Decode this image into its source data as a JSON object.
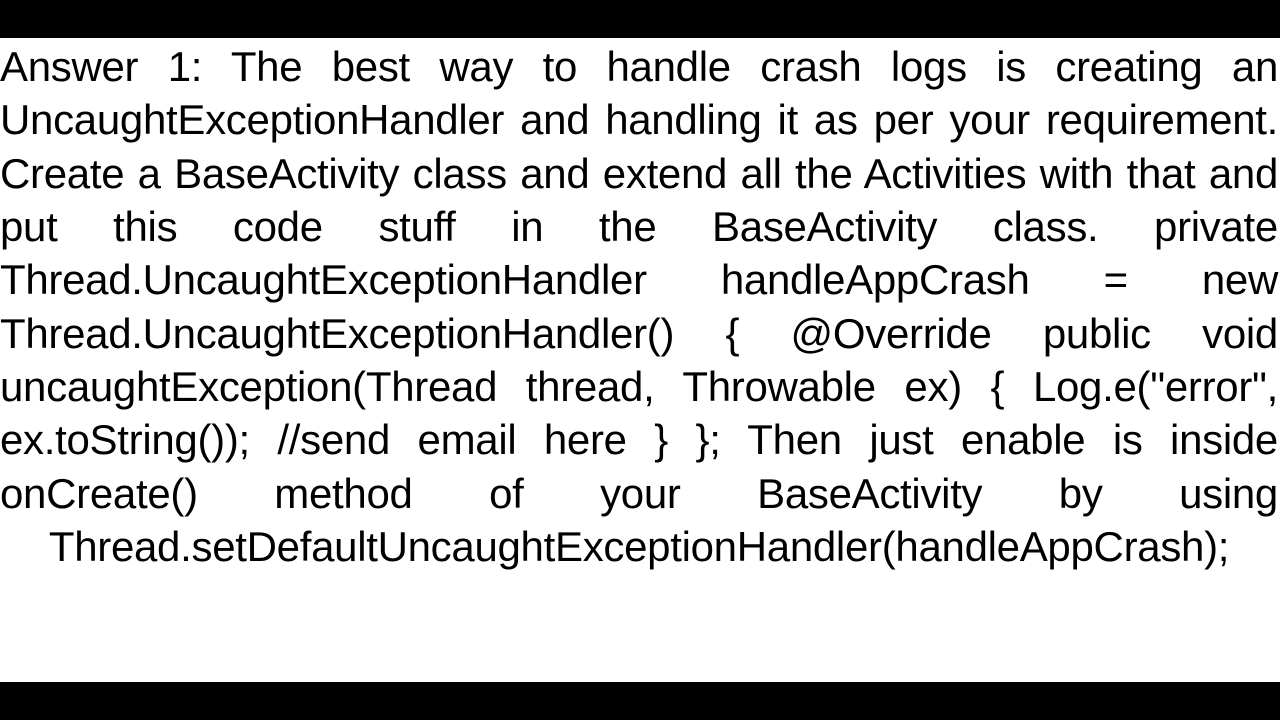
{
  "answer": {
    "text": "Answer 1: The best way to handle crash logs is creating an UncaughtExceptionHandler and handling it as per your requirement. Create a BaseActivity class and extend all the Activities with that and put this code stuff in the BaseActivity class. private Thread.UncaughtExceptionHandler handleAppCrash =                                         new Thread.UncaughtExceptionHandler() {     @Override     public void uncaughtException(Thread thread, Throwable ex) {         Log.e(\"error\", ex.toString());         //send email here     } };  Then just enable is inside onCreate() method of your BaseActivity by using Thread.setDefaultUncaughtExceptionHandler(handleAppCrash);"
  }
}
